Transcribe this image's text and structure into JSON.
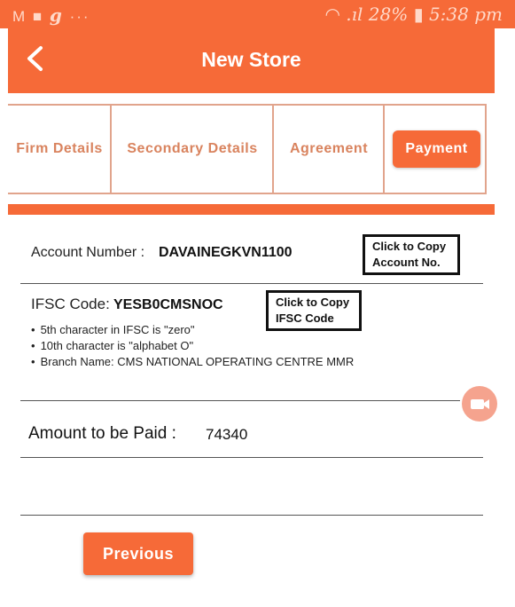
{
  "status_bar": {
    "left_icons": "M ■ g ···",
    "battery": "28%",
    "time": "5:38 pm"
  },
  "app_bar": {
    "title": "New Store",
    "back_icon": "chevron-left-icon"
  },
  "tabs": [
    {
      "label": "Firm Details"
    },
    {
      "label": "Secondary Details"
    },
    {
      "label": "Agreement"
    },
    {
      "label": "Payment",
      "active": true
    }
  ],
  "account": {
    "label": "Account Number :",
    "value": "DAVAINEGKVN1100",
    "copy_hint": [
      "Click to Copy",
      "Account No."
    ]
  },
  "ifsc": {
    "label": "IFSC Code:",
    "value": "YESB0CMSNOC",
    "copy_hint": [
      "Click to Copy",
      "IFSC Code"
    ],
    "notes": [
      "5th character in IFSC is \"zero\"",
      "10th character is \"alphabet O\"",
      "Branch Name: CMS NATIONAL OPERATING CENTRE MMR"
    ]
  },
  "amount": {
    "label": "Amount to be Paid :",
    "value": "74340"
  },
  "actions": {
    "previous_label": "Previous"
  },
  "colors": {
    "primary": "#f66a38",
    "tab_text": "#d9835e",
    "tab_border": "#e1a48c"
  }
}
